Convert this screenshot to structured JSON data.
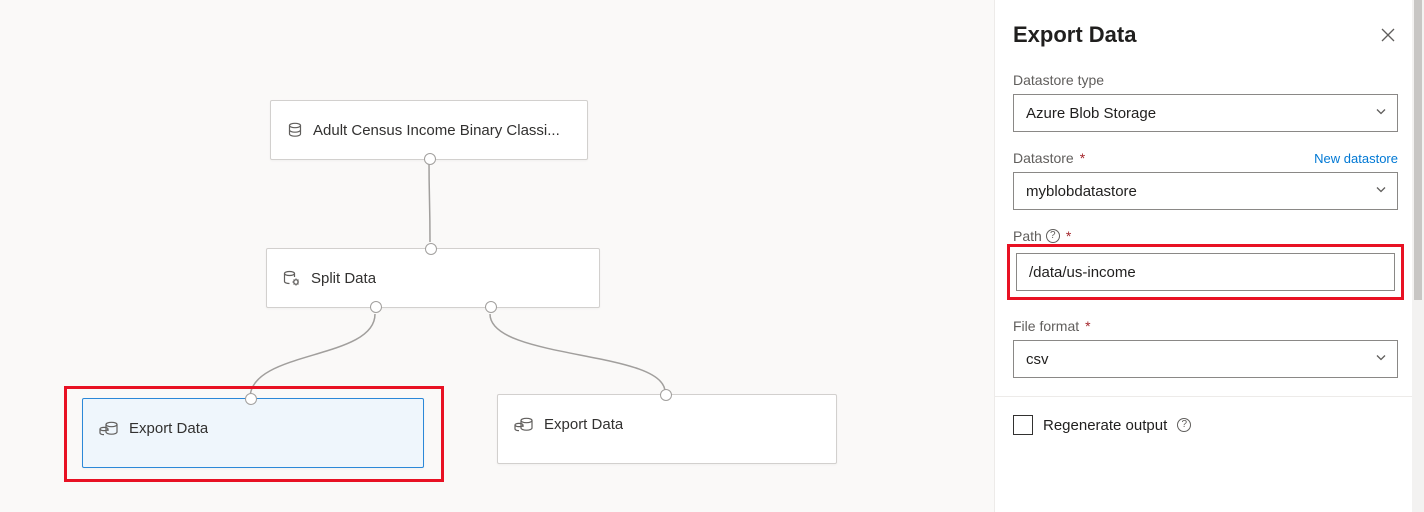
{
  "panel": {
    "title": "Export Data",
    "fields": {
      "datastore_type": {
        "label": "Datastore type",
        "value": "Azure Blob Storage"
      },
      "datastore": {
        "label": "Datastore",
        "value": "myblobdatastore",
        "action": "New datastore"
      },
      "path": {
        "label": "Path",
        "value": "/data/us-income"
      },
      "file_format": {
        "label": "File format",
        "value": "csv"
      },
      "regenerate": {
        "label": "Regenerate output",
        "checked": false
      }
    }
  },
  "canvas": {
    "nodes": {
      "dataset": {
        "label": "Adult Census Income Binary Classi..."
      },
      "split": {
        "label": "Split Data"
      },
      "export_l": {
        "label": "Export Data"
      },
      "export_r": {
        "label": "Export Data"
      }
    }
  },
  "icons": {
    "database": "database-icon",
    "split": "database-gear-icon",
    "export": "export-database-icon",
    "close": "close-icon",
    "chevron": "chevron-down-icon",
    "info": "info-icon"
  }
}
